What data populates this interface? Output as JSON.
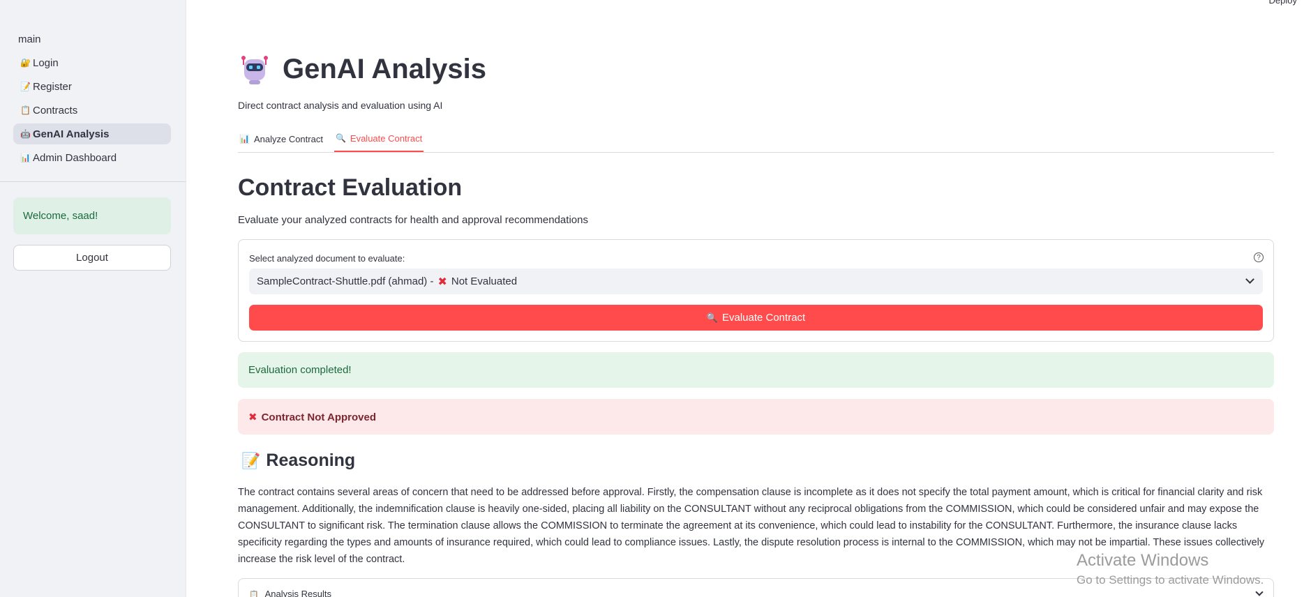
{
  "topbar": {
    "deploy_label": "Deploy"
  },
  "sidebar": {
    "section_title": "main",
    "items": [
      {
        "icon": "🔐",
        "label": "Login",
        "active": false
      },
      {
        "icon": "📝",
        "label": "Register",
        "active": false
      },
      {
        "icon": "📋",
        "label": "Contracts",
        "active": false
      },
      {
        "icon": "🤖",
        "label": "GenAI Analysis",
        "active": true
      },
      {
        "icon": "📊",
        "label": "Admin Dashboard",
        "active": false
      }
    ],
    "welcome": "Welcome, saad!",
    "logout_label": "Logout"
  },
  "header": {
    "title": "GenAI Analysis",
    "subtitle": "Direct contract analysis and evaluation using AI"
  },
  "tabs": [
    {
      "icon": "📊",
      "label": "Analyze Contract",
      "active": false
    },
    {
      "icon": "🔍",
      "label": "Evaluate Contract",
      "active": true
    }
  ],
  "evaluation": {
    "title": "Contract Evaluation",
    "subtitle": "Evaluate your analyzed contracts for health and approval recommendations",
    "select_label": "Select analyzed document to evaluate:",
    "select_value_prefix": "SampleContract-Shuttle.pdf (ahmad) -",
    "select_value_status": "Not Evaluated",
    "button_icon": "🔍",
    "button_label": "Evaluate Contract",
    "success_message": "Evaluation completed!",
    "error_message": "Contract Not Approved"
  },
  "reasoning": {
    "icon": "📝",
    "title": "Reasoning",
    "text": "The contract contains several areas of concern that need to be addressed before approval. Firstly, the compensation clause is incomplete as it does not specify the total payment amount, which is critical for financial clarity and risk management. Additionally, the indemnification clause is heavily one-sided, placing all liability on the CONSULTANT without any reciprocal obligations from the COMMISSION, which could be considered unfair and may expose the CONSULTANT to significant risk. The termination clause allows the COMMISSION to terminate the agreement at its convenience, which could lead to instability for the CONSULTANT. Furthermore, the insurance clause lacks specificity regarding the types and amounts of insurance required, which could lead to compliance issues. Lastly, the dispute resolution process is internal to the COMMISSION, which may not be impartial. These issues collectively increase the risk level of the contract."
  },
  "expander": {
    "icon": "📋",
    "label": "Analysis Results"
  },
  "watermark": {
    "line1": "Activate Windows",
    "line2": "Go to Settings to activate Windows."
  },
  "colors": {
    "accent": "#ff4b4b",
    "success_bg": "#e6f5ea",
    "error_bg": "#fde9ea",
    "sidebar_bg": "#f0f2f6"
  }
}
